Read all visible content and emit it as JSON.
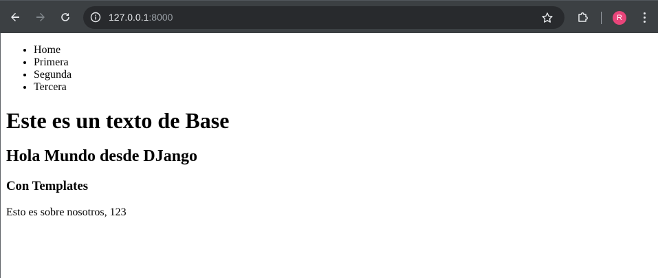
{
  "browser": {
    "url_host": "127.0.0.1",
    "url_port": ":8000",
    "profile_initial": "R",
    "icons": {
      "back": "back-arrow-icon",
      "forward": "forward-arrow-icon",
      "reload": "reload-icon",
      "site_info": "info-icon",
      "bookmark": "star-icon",
      "extensions": "puzzle-icon",
      "menu": "kebab-menu-icon"
    },
    "colors": {
      "toolbar": "#3c4043",
      "omnibox": "#282a2d",
      "avatar": "#e8457a"
    }
  },
  "page": {
    "nav_items": [
      {
        "label": "Home"
      },
      {
        "label": "Primera"
      },
      {
        "label": "Segunda"
      },
      {
        "label": "Tercera"
      }
    ],
    "base_heading": "Este es un texto de Base",
    "subheading": "Hola Mundo desde DJango",
    "templates_heading": "Con Templates",
    "about_text": "Esto es sobre nosotros, 123"
  }
}
